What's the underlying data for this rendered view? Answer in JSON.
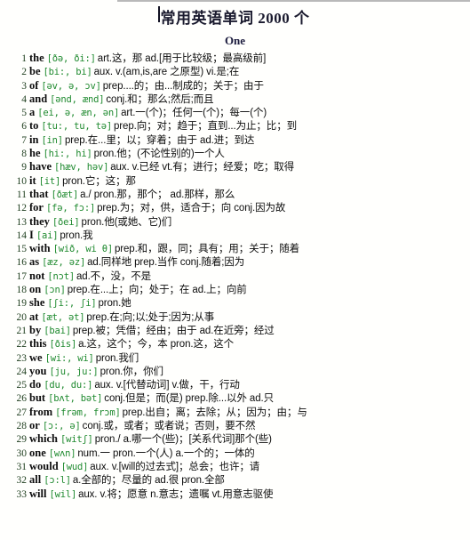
{
  "document": {
    "title": "常用英语单词 2000 个",
    "section_heading": "One",
    "caret_visible": true,
    "colors": {
      "page_background": "#fffffd",
      "title_text": "#1a1a2e",
      "heading_text": "#1a1a3c",
      "entry_number": "#1d3d1d",
      "headword": "#0d0d0d",
      "phonetic": "#1f8a2f",
      "definition": "#0d0d0d",
      "top_rule": "#b9b9b9"
    }
  },
  "entries": [
    {
      "num": "1",
      "word": "the",
      "phonetic": "[ðə,  ði:]",
      "definition": "art.这，那 ad.[用于比较级；最高级前]"
    },
    {
      "num": "2",
      "word": "be",
      "phonetic": "[bi:, bi]",
      "definition": "aux. v.(am,is,are 之原型) vi.是;在"
    },
    {
      "num": "3",
      "word": "of",
      "phonetic": "[əv,  ə,  ɔv]",
      "definition": "prep....的；由...制成的；关于；由于"
    },
    {
      "num": "4",
      "word": "and",
      "phonetic": "[ənd,  ænd]",
      "definition": "conj.和；那么;然后;而且"
    },
    {
      "num": "5",
      "word": "a",
      "phonetic": "[ei,  ə,  æn,  ən]",
      "definition": "art.一(个)；任何一(个)；每一(个)"
    },
    {
      "num": "6",
      "word": "to",
      "phonetic": "[tu:,  tu,  tə]",
      "definition": "prep.向；对；趋于；直到...为止；比；到"
    },
    {
      "num": "7",
      "word": "in",
      "phonetic": "[in]",
      "definition": "prep.在...里；以；穿着；由于 ad.进；到达"
    },
    {
      "num": "8",
      "word": "he",
      "phonetic": "[hi:,  hi]",
      "definition": "pron.他；(不论性别的)一个人"
    },
    {
      "num": "9",
      "word": "have",
      "phonetic": "[hæv, həv]",
      "definition": "aux. v.已经 vt.有；进行；经爱；吃；取得"
    },
    {
      "num": "10",
      "word": "it",
      "phonetic": "[it]",
      "definition": "pron.它；这；那"
    },
    {
      "num": "11",
      "word": "that",
      "phonetic": "[ðæt]",
      "definition": "a./ pron.那，那个； ad.那样，那么"
    },
    {
      "num": "12",
      "word": "for",
      "phonetic": "[fə,  fɔ:]",
      "definition": "prep.为；对，供，适合于；向 conj.因为故"
    },
    {
      "num": "13",
      "word": "they",
      "phonetic": "[ðei]",
      "definition": "pron.他(或她、它)们"
    },
    {
      "num": "14",
      "word": "I",
      "phonetic": "[ai]",
      "definition": "pron.我"
    },
    {
      "num": "15",
      "word": "with",
      "phonetic": "[wið,  wi θ]",
      "definition": "prep.和，跟，同；具有；用；关于；随着"
    },
    {
      "num": "16",
      "word": "as",
      "phonetic": "[æz,  əz]",
      "definition": "ad.同样地 prep.当作 conj.随着;因为"
    },
    {
      "num": "17",
      "word": "not",
      "phonetic": "[nɔt]",
      "definition": "ad.不，没，不是"
    },
    {
      "num": "18",
      "word": "on",
      "phonetic": "[ɔn]",
      "definition": "prep.在...上；向；处于；在 ad.上；向前"
    },
    {
      "num": "19",
      "word": "she",
      "phonetic": "[ʃi:,  ʃi]",
      "definition": "pron.她"
    },
    {
      "num": "20",
      "word": "at",
      "phonetic": "[æt,  ət]",
      "definition": "prep.在;向;以;处于;因为;从事"
    },
    {
      "num": "21",
      "word": "by",
      "phonetic": "[bai]",
      "definition": "prep.被；凭借；经由；由于 ad.在近旁；经过"
    },
    {
      "num": "22",
      "word": "this",
      "phonetic": "[ðis]",
      "definition": "a.这，这个；今，本 pron.这，这个"
    },
    {
      "num": "23",
      "word": "we",
      "phonetic": "[wi:,  wi]",
      "definition": "pron.我们"
    },
    {
      "num": "24",
      "word": "you",
      "phonetic": "[ju,  ju:]",
      "definition": "pron.你，你们"
    },
    {
      "num": "25",
      "word": "do",
      "phonetic": "[du,  du:]",
      "definition": "aux. v.[代替动词] v.做，干，行动"
    },
    {
      "num": "26",
      "word": "but",
      "phonetic": "[bʌt, bət]",
      "definition": "conj.但是；而(是) prep.除...以外 ad.只"
    },
    {
      "num": "27",
      "word": "from",
      "phonetic": "[frəm, frɔm]",
      "definition": "prep.出自；离；去除；从；因为；由；与"
    },
    {
      "num": "28",
      "word": "or",
      "phonetic": "[ɔ:,  ə]",
      "definition": "conj.或，或者；或者说；否则，要不然"
    },
    {
      "num": "29",
      "word": "which",
      "phonetic": "[witʃ]",
      "definition": "pron./ a.哪一个(些)；[关系代词]那个(些)"
    },
    {
      "num": "30",
      "word": "one",
      "phonetic": "[wʌn]",
      "definition": "num.一 pron.一个(人) a.一个的；一体的"
    },
    {
      "num": "31",
      "word": "would",
      "phonetic": "[wud]",
      "definition": "aux. v.[will的过去式]；总会；也许；请"
    },
    {
      "num": "32",
      "word": "all",
      "phonetic": "[ɔ:l]",
      "definition": "a.全部的；尽量的 ad.很 pron.全部"
    },
    {
      "num": "33",
      "word": "will",
      "phonetic": "[wil]",
      "definition": "aux. v.将；愿意 n.意志；遗嘱 vt.用意志驱使"
    }
  ]
}
